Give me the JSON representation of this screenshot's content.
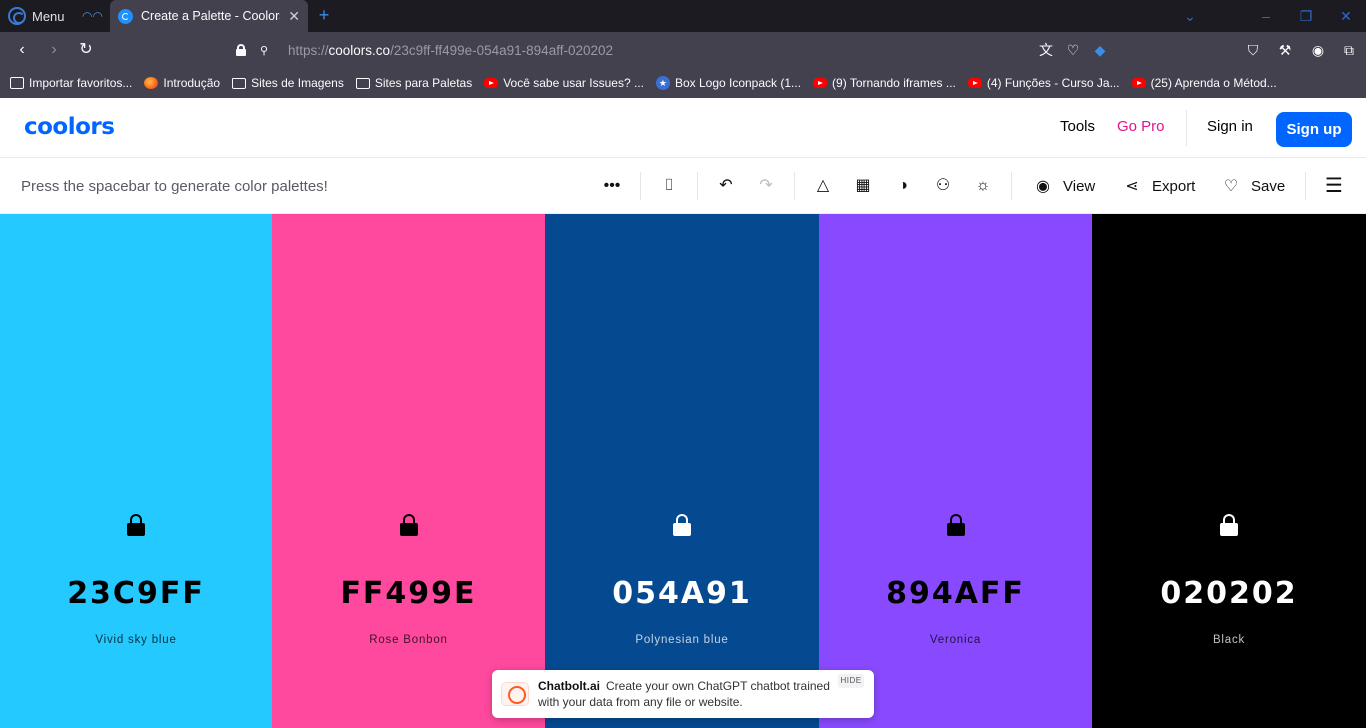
{
  "browser": {
    "menu_label": "Menu",
    "tab": {
      "title": "Create a Palette - Coolors",
      "close": "✕"
    },
    "new_tab": "+",
    "url": {
      "prefix": "https://",
      "host": "coolors.co",
      "path": "/23c9ff-ff499e-054a91-894aff-020202"
    },
    "bookmarks": [
      {
        "icon": "import-icon",
        "label": "Importar favoritos..."
      },
      {
        "icon": "firefox-icon",
        "label": "Introdução"
      },
      {
        "icon": "folder-icon",
        "label": "Sites de Imagens"
      },
      {
        "icon": "folder-icon",
        "label": "Sites para Paletas"
      },
      {
        "icon": "youtube-icon",
        "label": "Você sabe usar Issues? ..."
      },
      {
        "icon": "star-icon",
        "label": "Box Logo Iconpack (1..."
      },
      {
        "icon": "youtube-icon",
        "label": "(9) Tornando iframes ..."
      },
      {
        "icon": "youtube-icon",
        "label": "(4) Funções - Curso Ja..."
      },
      {
        "icon": "youtube-icon",
        "label": "(25) Aprenda o Métod..."
      }
    ]
  },
  "app": {
    "logo": "coolors",
    "header": {
      "tools": "Tools",
      "go_pro": "Go Pro",
      "sign_in": "Sign in",
      "sign_up": "Sign up"
    },
    "toolbar": {
      "hint": "Press the spacebar to generate color palettes!",
      "view": "View",
      "export": "Export",
      "save": "Save"
    },
    "palette": [
      {
        "hex": "23C9FF",
        "name": "Vivid sky blue",
        "color": "#23c9ff",
        "text": "#000000"
      },
      {
        "hex": "FF499E",
        "name": "Rose Bonbon",
        "color": "#ff499e",
        "text": "#000000"
      },
      {
        "hex": "054A91",
        "name": "Polynesian blue",
        "color": "#054a91",
        "text": "#ffffff"
      },
      {
        "hex": "894AFF",
        "name": "Veronica",
        "color": "#894aff",
        "text": "#000000"
      },
      {
        "hex": "020202",
        "name": "Black",
        "color": "#000000",
        "text": "#ffffff"
      }
    ],
    "toast": {
      "brand": "Chatbolt.ai",
      "message": "Create your own ChatGPT chatbot trained with your data from any file or website.",
      "hide": "HIDE"
    }
  }
}
